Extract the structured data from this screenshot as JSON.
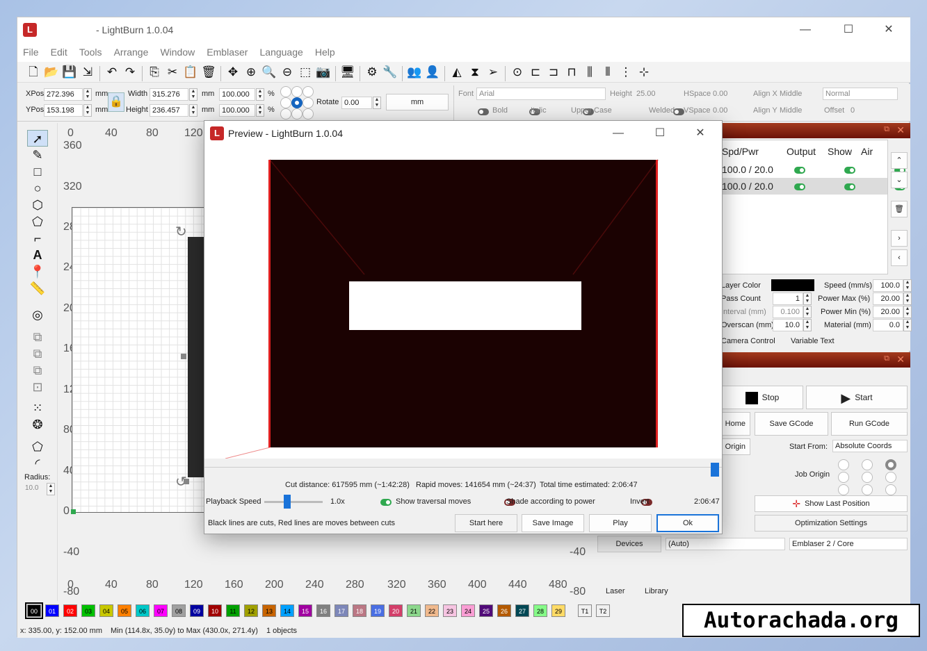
{
  "window": {
    "title": "- LightBurn 1.0.04",
    "logo": "L",
    "min": "—",
    "max": "☐",
    "close": "✕"
  },
  "menu": [
    "File",
    "Edit",
    "Tools",
    "Arrange",
    "Window",
    "Emblaser",
    "Language",
    "Help"
  ],
  "props": {
    "xpos_label": "XPos",
    "xpos": "272.396",
    "ypos_label": "YPos",
    "ypos": "153.198",
    "unit": "mm",
    "width_label": "Width",
    "width": "315.276",
    "height_label": "Height",
    "height": "236.457",
    "pct_w": "100.000",
    "pct_h": "100.000",
    "pct": "%",
    "rotate_label": "Rotate",
    "rotate": "0.00",
    "mm_button": "mm",
    "font_label": "Font",
    "font": "Arial",
    "font_height_label": "Height",
    "font_height": "25.00",
    "hspace_label": "HSpace",
    "hspace": "0.00",
    "vspace_label": "VSpace",
    "vspace": "0.00",
    "alignx_label": "Align X",
    "alignx": "Middle",
    "aligny_label": "Align Y",
    "aligny": "Middle",
    "style": "Normal",
    "offset_label": "Offset",
    "offset": "0",
    "bold": "Bold",
    "italic": "Italic",
    "upper": "Upper Case",
    "welded": "Welded"
  },
  "rulers": {
    "top": [
      "0",
      "40",
      "80",
      "120"
    ],
    "bottom": [
      "0",
      "40",
      "80",
      "120",
      "160",
      "200",
      "240",
      "280",
      "320",
      "360",
      "400",
      "440",
      "480"
    ],
    "left": [
      "360",
      "320",
      "280",
      "240",
      "200",
      "160",
      "120",
      "80",
      "40",
      "0",
      "-40",
      "-80"
    ],
    "right": [
      "-40",
      "-80"
    ]
  },
  "radius_label": "Radius:",
  "radius": "10.0",
  "cuts": {
    "headers": [
      "Spd/Pwr",
      "Output",
      "Show",
      "Air"
    ],
    "rows": [
      {
        "spd": "100.0 / 20.0"
      },
      {
        "spd": "100.0 / 20.0"
      }
    ]
  },
  "layer": {
    "color_label": "Layer Color",
    "pass_label": "Pass Count",
    "pass": "1",
    "interval_label": "Interval (mm)",
    "interval": "0.100",
    "overscan_label": "Overscan (mm)",
    "overscan": "10.0",
    "speed_label": "Speed (mm/s)",
    "speed": "100.0",
    "pmax_label": "Power Max (%)",
    "pmax": "20.00",
    "pmin_label": "Power Min (%)",
    "pmin": "20.00",
    "material_label": "Material (mm)",
    "material": "0.0",
    "tab1": "Camera Control",
    "tab2": "Variable Text"
  },
  "laser": {
    "stop": "Stop",
    "start": "Start",
    "home": "Home",
    "save_gcode": "Save GCode",
    "run_gcode": "Run GCode",
    "origin": "Origin",
    "start_from_label": "Start From:",
    "start_from": "Absolute Coords",
    "job_origin_label": "Job Origin",
    "show_last": "Show Last Position",
    "optim": "Optimization Settings",
    "devices": "Devices",
    "auto": "(Auto)",
    "device": "Emblaser 2 / Core",
    "tab_laser": "Laser",
    "tab_library": "Library"
  },
  "swatches": [
    "00",
    "01",
    "02",
    "03",
    "04",
    "05",
    "06",
    "07",
    "08",
    "09",
    "10",
    "11",
    "12",
    "13",
    "14",
    "15",
    "16",
    "17",
    "18",
    "19",
    "20",
    "21",
    "22",
    "23",
    "24",
    "25",
    "26",
    "27",
    "28",
    "29",
    "T1",
    "T2"
  ],
  "swatch_colors": [
    "#000000",
    "#0000ff",
    "#ff0000",
    "#00c000",
    "#c8c800",
    "#ff8000",
    "#00c8c8",
    "#ff00ff",
    "#a0a0a0",
    "#0000a0",
    "#a00000",
    "#00a000",
    "#a0a000",
    "#c86400",
    "#00a0ff",
    "#a000a0",
    "#808080",
    "#7d87b9",
    "#bb7784",
    "#4a6fe3",
    "#d33f6a",
    "#8cd78c",
    "#f0b98d",
    "#f6c4e1",
    "#fa9ed4",
    "#500a78",
    "#b45a00",
    "#004754",
    "#86fa88",
    "#ffdb66",
    "#f0f0f0",
    "#f0f0f0"
  ],
  "status": {
    "coords": "x: 335.00, y: 152.00 mm",
    "minmax": "Min (114.8x, 35.0y) to Max (430.0x, 271.4y)",
    "objects": "1 objects"
  },
  "preview": {
    "title": "Preview - LightBurn 1.0.04",
    "cut_distance": "Cut distance: 617595 mm (~1:42:28)",
    "rapid_moves": "Rapid moves: 141654 mm (~24:37)",
    "total_time": "Total time estimated: 2:06:47",
    "playback_label": "Playback Speed",
    "playback": "1.0x",
    "show_traversal": "Show traversal moves",
    "shade": "Shade according to power",
    "invert": "Invert",
    "time": "2:06:47",
    "legend": "Black lines are cuts, Red lines are moves between cuts",
    "start_here": "Start here",
    "save_image": "Save Image",
    "play": "Play",
    "ok": "Ok"
  },
  "watermark": "Autorachada.org"
}
